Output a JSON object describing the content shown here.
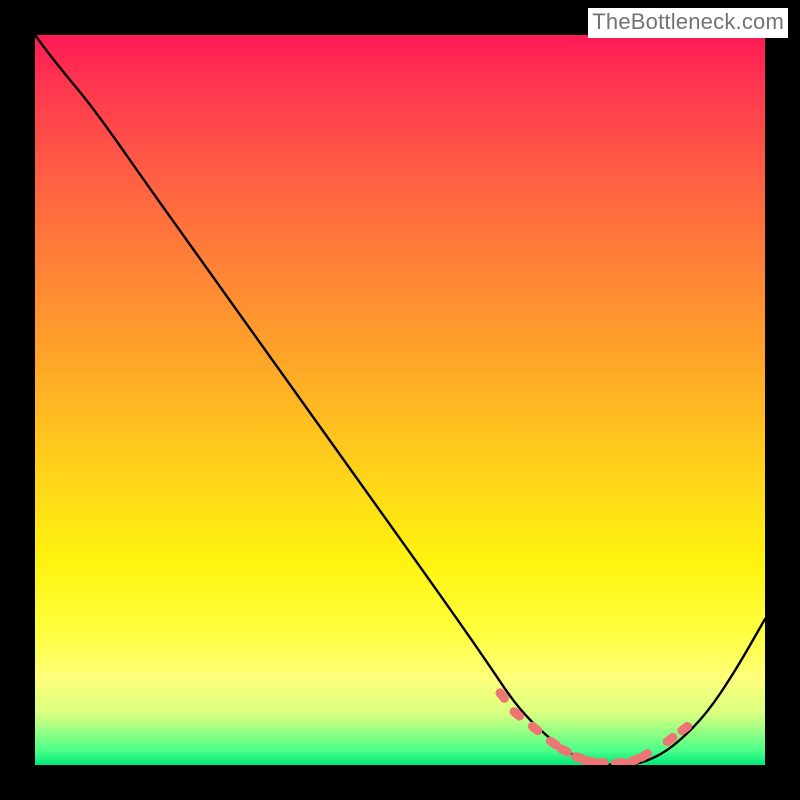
{
  "watermark": "TheBottleneck.com",
  "chart_data": {
    "type": "line",
    "title": "",
    "xlabel": "",
    "ylabel": "",
    "xlim": [
      0,
      100
    ],
    "ylim": [
      0,
      100
    ],
    "series": [
      {
        "name": "curve",
        "x": [
          0,
          3,
          8,
          15,
          25,
          35,
          45,
          55,
          62,
          66,
          70,
          74,
          78,
          82,
          85,
          88,
          92,
          96,
          100
        ],
        "y": [
          100,
          96,
          90,
          80,
          66,
          52,
          38,
          24,
          14,
          8,
          4,
          1,
          0,
          0,
          1,
          3,
          7,
          13,
          20
        ]
      }
    ],
    "highlight_points": {
      "x": [
        64,
        66,
        68.5,
        71,
        72.5,
        74.5,
        76,
        77.5,
        80,
        82,
        83.5,
        87,
        89
      ],
      "y": [
        9.5,
        7,
        5,
        3,
        2,
        1,
        0.5,
        0.3,
        0.3,
        0.6,
        1.3,
        3.5,
        5
      ]
    },
    "background_gradient": {
      "top": "#ff1956",
      "bottom": "#00e77a"
    }
  }
}
